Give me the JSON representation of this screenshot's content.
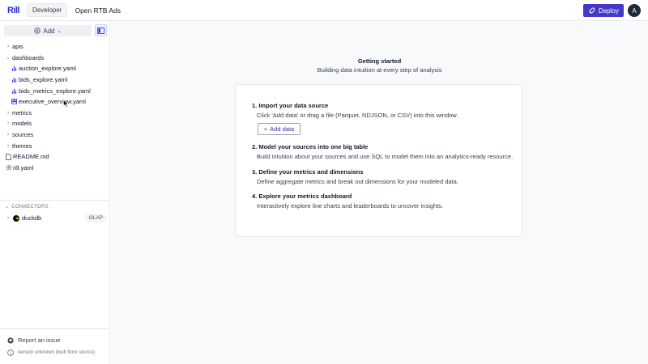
{
  "header": {
    "logo_text": "Rill",
    "environment_badge": "Developer",
    "project_name": "Open RTB Ads",
    "deploy_label": "Deploy",
    "avatar_initial": "A"
  },
  "sidebar": {
    "add_label": "Add",
    "tree": [
      {
        "label": "apis",
        "type": "folder",
        "expanded": false
      },
      {
        "label": "dashboards",
        "type": "folder",
        "expanded": true
      },
      {
        "label": "auction_explore.yaml",
        "type": "explore"
      },
      {
        "label": "bids_explore.yaml",
        "type": "explore"
      },
      {
        "label": "bids_metrics_explore.yaml",
        "type": "explore"
      },
      {
        "label": "executive_overview.yaml",
        "type": "canvas"
      },
      {
        "label": "metrics",
        "type": "folder",
        "expanded": false
      },
      {
        "label": "models",
        "type": "folder",
        "expanded": false
      },
      {
        "label": "sources",
        "type": "folder",
        "expanded": false
      },
      {
        "label": "themes",
        "type": "folder",
        "expanded": false
      },
      {
        "label": "README.md",
        "type": "file"
      },
      {
        "label": "rill.yaml",
        "type": "settings"
      }
    ],
    "connectors_header": "CONNECTORS",
    "connector": {
      "name": "duckdb",
      "badge": "OLAP"
    },
    "report_issue": "Report an issue",
    "version": "version unknown (built from source)"
  },
  "main": {
    "title": "Getting started",
    "subtitle": "Building data intuition at every step of analysis",
    "steps": [
      {
        "title": "1. Import your data source",
        "desc": "Click 'Add data' or drag a file (Parquet, NDJSON, or CSV) into this window."
      },
      {
        "title": "2. Model your sources into one big table",
        "desc": "Build intuition about your sources and use SQL to model them into an analytics-ready resource."
      },
      {
        "title": "3. Define your metrics and dimensions",
        "desc": "Define aggregate metrics and break out dimensions for your modeled data."
      },
      {
        "title": "4. Explore your metrics dashboard",
        "desc": "Interactively explore line charts and leaderboards to uncover insights."
      }
    ],
    "add_data_label": "Add data"
  },
  "colors": {
    "accent": "#4338ca",
    "brand": "#2d2ed2"
  }
}
